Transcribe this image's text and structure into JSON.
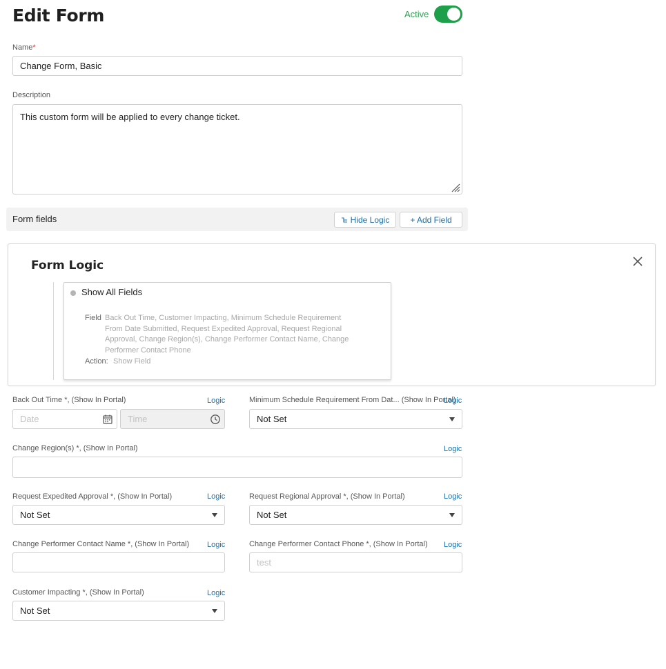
{
  "header": {
    "title": "Edit Form",
    "active_label": "Active",
    "active": true
  },
  "name_field": {
    "label": "Name",
    "required_mark": "*",
    "value": "Change Form, Basic"
  },
  "description_field": {
    "label": "Description",
    "value": "This custom form will be applied to every change ticket."
  },
  "form_fields_bar": {
    "title": "Form fields",
    "hide_logic_label": "Hide Logic",
    "add_field_label": "+ Add Field"
  },
  "form_logic": {
    "title": "Form Logic",
    "rule_title": "Show All Fields",
    "field_key": "Field",
    "field_value_lines": [
      "Back Out Time, Customer Impacting, Minimum Schedule Requirement",
      "From Date Submitted, Request Expedited Approval, Request Regional",
      "Approval, Change Region(s), Change Performer Contact Name, Change",
      "Performer Contact Phone"
    ],
    "action_key": "Action:",
    "action_value": "Show Field"
  },
  "fields": {
    "logic_label": "Logic",
    "back_out_time": {
      "label": "Back Out Time  *, (Show In Portal)",
      "date_placeholder": "Date",
      "time_placeholder": "Time"
    },
    "min_schedule": {
      "label": "Minimum Schedule Requirement From Dat...  (Show In Portal)",
      "value": "Not Set"
    },
    "change_regions": {
      "label": "Change Region(s)  *, (Show In Portal)",
      "value": ""
    },
    "request_expedited": {
      "label": "Request Expedited Approval  *, (Show In Portal)",
      "value": "Not Set"
    },
    "request_regional": {
      "label": "Request Regional Approval  *, (Show In Portal)",
      "value": "Not Set"
    },
    "performer_name": {
      "label": "Change Performer Contact Name  *, (Show In Portal)",
      "value": ""
    },
    "performer_phone": {
      "label": "Change Performer Contact Phone  *, (Show In Portal)",
      "placeholder": "test"
    },
    "customer_impacting": {
      "label": "Customer Impacting  *, (Show In Portal)",
      "value": "Not Set"
    }
  },
  "colors": {
    "accent_green": "#1e9f4a",
    "link_blue": "#1b6fa8"
  }
}
